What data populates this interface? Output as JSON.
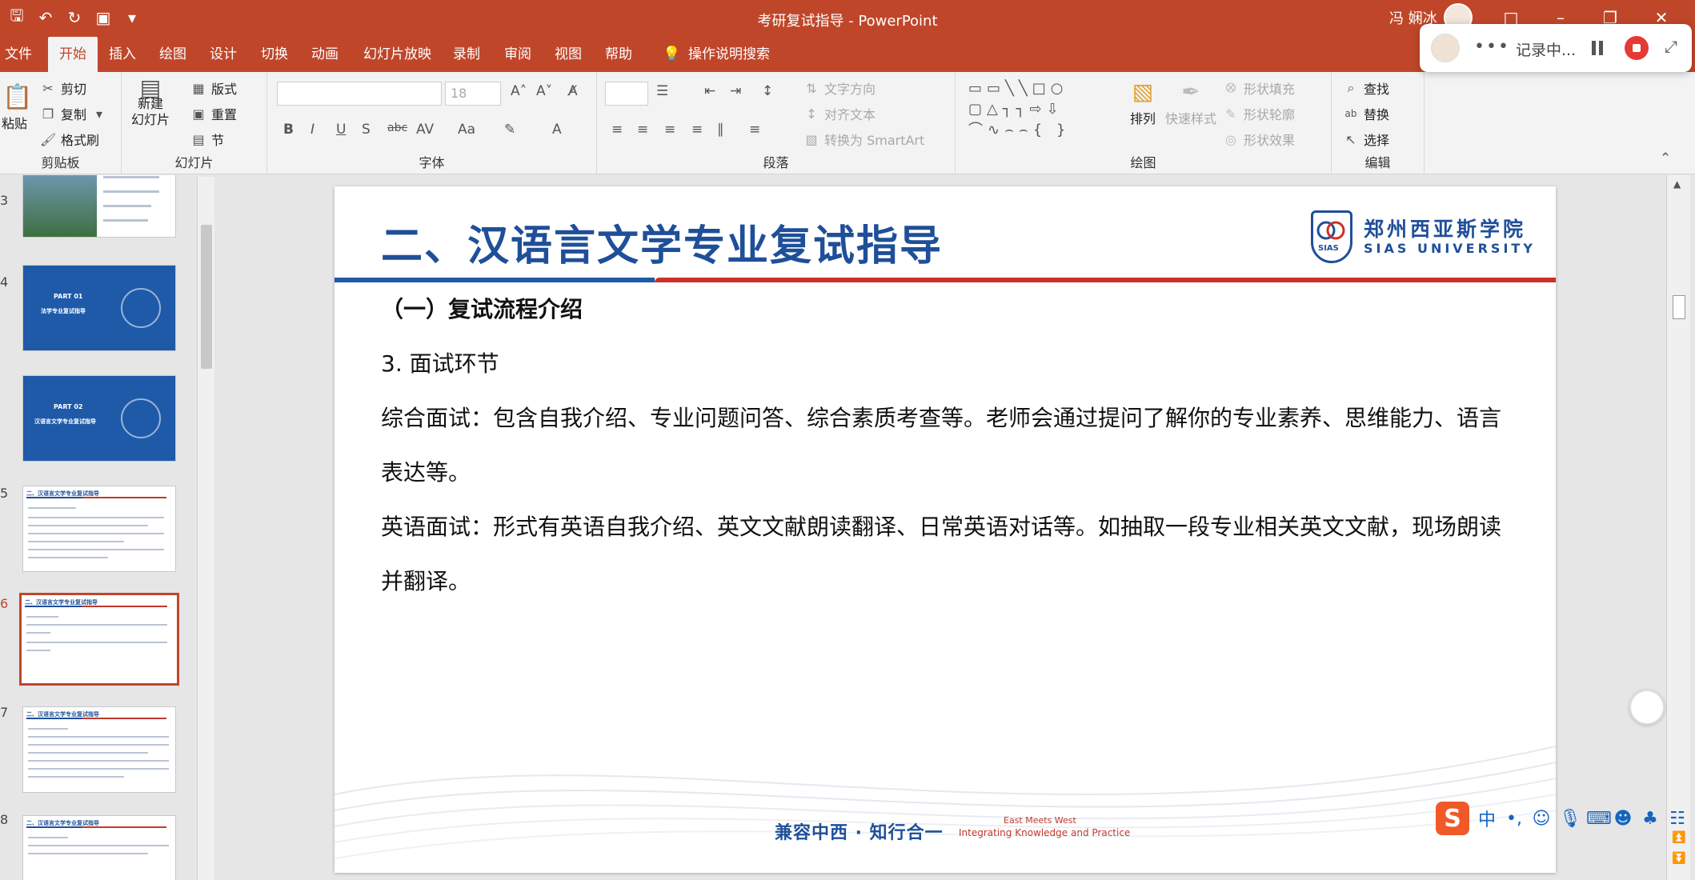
{
  "window": {
    "doc_title": "考研复试指导 - PowerPoint",
    "user_name": "冯 娴冰"
  },
  "tabs": [
    "文件",
    "开始",
    "插入",
    "绘图",
    "设计",
    "切换",
    "动画",
    "幻灯片放映",
    "录制",
    "审阅",
    "视图",
    "帮助",
    "操作说明搜索"
  ],
  "active_tab": "开始",
  "ribbon": {
    "clipboard": {
      "label": "剪贴板",
      "paste": "粘贴",
      "cut": "剪切",
      "copy": "复制",
      "format_painter": "格式刷"
    },
    "slides": {
      "label": "幻灯片",
      "new_slide_1": "新建",
      "new_slide_2": "幻灯片",
      "layout": "版式",
      "reset": "重置",
      "section": "节"
    },
    "font": {
      "label": "字体",
      "size": "18"
    },
    "paragraph": {
      "label": "段落",
      "text_direction": "文字方向",
      "align_text": "对齐文本",
      "convert_smartart": "转换为 SmartArt"
    },
    "drawing": {
      "label": "绘图",
      "arrange": "排列",
      "quick_styles": "快速样式",
      "shape_fill": "形状填充",
      "shape_outline": "形状轮廓",
      "shape_effects": "形状效果"
    },
    "editing": {
      "label": "编辑",
      "find": "查找",
      "replace": "替换",
      "select": "选择"
    }
  },
  "recorder": {
    "status": "记录中..."
  },
  "thumbnails": {
    "numbers": [
      "3",
      "4",
      "5",
      "6",
      "7",
      "8"
    ],
    "part1": "PART 01",
    "part1_sub": "法学专业复试指导",
    "part2": "PART 02",
    "part2_sub": "汉语言文学专业复试指导",
    "slide_head": "二、汉语言文学专业复试指导"
  },
  "slide": {
    "title": "二、汉语言文学专业复试指导",
    "logo_cn": "郑州西亚斯学院",
    "logo_en": "SIAS UNIVERSITY",
    "logo_badge": "SIAS",
    "section_heading": "（一）复试流程介绍",
    "item": "3. 面试环节",
    "p1_line1": "综合面试：包含自我介绍、专业问题问答、综合素质考查等。老师会通过提问了解你的专业素养、思维能力、语言",
    "p1_line2": "表达等。",
    "p2_line1": "英语面试：形式有英语自我介绍、英文文献朗读翻译、日常英语对话等。如抽取一段专业相关英文文献，现场朗读",
    "p2_line2": "并翻译。",
    "footer_motto": "兼容中西 · 知行合一",
    "footer_en1": "East Meets West",
    "footer_en2": "Integrating Knowledge and Practice"
  },
  "ime": {
    "lang": "中"
  },
  "colors": {
    "accent": "#c0462a",
    "brand_blue": "#1f4f99",
    "brand_red": "#c9322a"
  }
}
